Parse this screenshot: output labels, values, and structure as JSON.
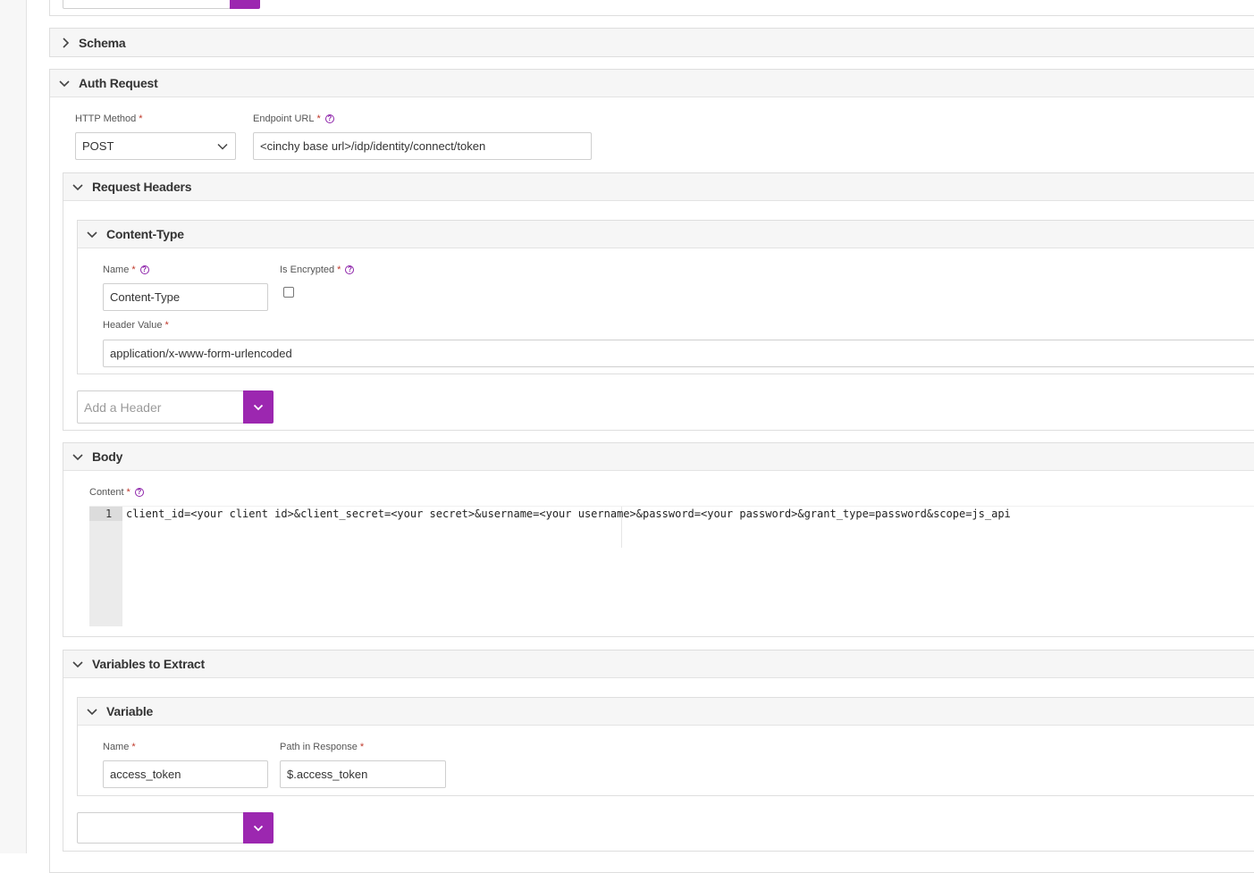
{
  "panels": {
    "schema": "Schema",
    "auth_request": "Auth Request",
    "request_headers": "Request Headers",
    "content_type": "Content-Type",
    "body": "Body",
    "variables_to_extract": "Variables to Extract",
    "variable": "Variable"
  },
  "auth": {
    "http_method_label": "HTTP Method",
    "http_method_value": "POST",
    "endpoint_label": "Endpoint URL",
    "endpoint_value": "<cinchy base url>/idp/identity/connect/token"
  },
  "header": {
    "name_label": "Name",
    "name_value": "Content-Type",
    "encrypted_label": "Is Encrypted",
    "encrypted_checked": false,
    "value_label": "Header Value",
    "value_value": "application/x-www-form-urlencoded",
    "add_placeholder": "Add a Header"
  },
  "body": {
    "content_label": "Content",
    "line_number": "1",
    "line_text": "client_id=<your client id>&client_secret=<your secret>&username=<your username>&password=<your password>&grant_type=password&scope=js_api"
  },
  "variable": {
    "name_label": "Name",
    "name_value": "access_token",
    "path_label": "Path in Response",
    "path_value": "$.access_token"
  },
  "required_mark": "*",
  "help_mark": "?",
  "colors": {
    "accent": "#9c27b0",
    "required": "#c0392b"
  },
  "icons": {
    "collapsed": "chevron-right-icon",
    "expanded": "chevron-down-icon"
  }
}
